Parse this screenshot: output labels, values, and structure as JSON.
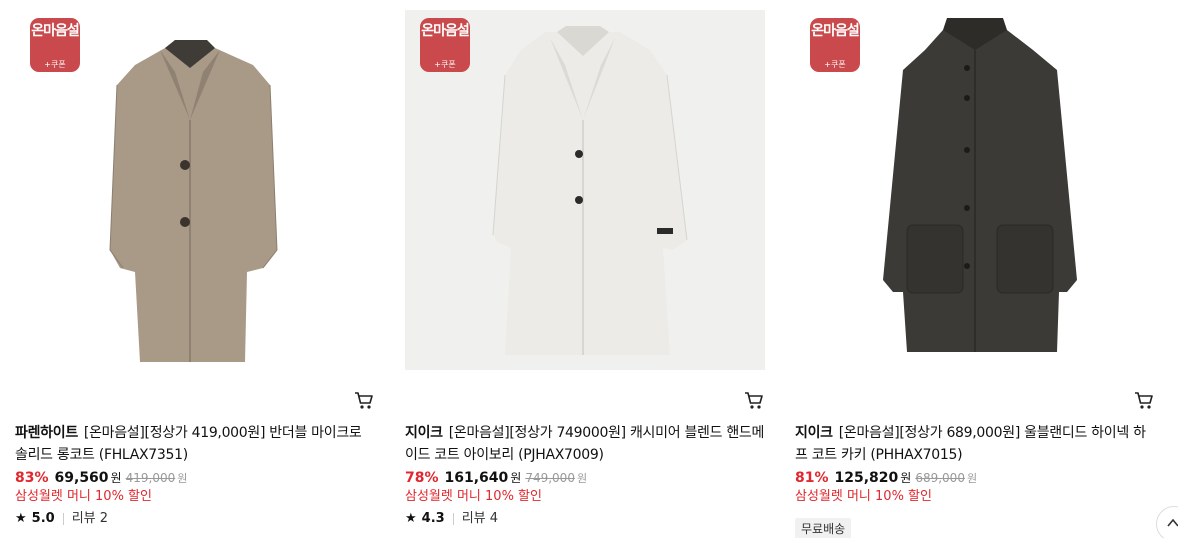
{
  "products": [
    {
      "badge_main": "온마음설",
      "badge_sub": "+쿠폰",
      "brand": "파렌하이트",
      "name": "[온마음설][정상가 419,000원] 반더블 마이크로 솔리드 롱코트 (FHLAX7351)",
      "discount_rate": "83%",
      "sale_price": "69,560",
      "currency": "원",
      "original_price": "419,000",
      "promo": "삼성월렛 머니 10% 할인",
      "rating": "5.0",
      "reviews": "리뷰 2",
      "image_icon": "coat-beige-image",
      "coat_color": "#a89886"
    },
    {
      "badge_main": "온마음설",
      "badge_sub": "+쿠폰",
      "brand": "지이크",
      "name": "[온마음설][정상가 749000원] 캐시미어 블렌드 핸드메이드 코트 아이보리 (PJHAX7009)",
      "discount_rate": "78%",
      "sale_price": "161,640",
      "currency": "원",
      "original_price": "749,000",
      "promo": "삼성월렛 머니 10% 할인",
      "rating": "4.3",
      "reviews": "리뷰 4",
      "image_icon": "coat-ivory-image",
      "coat_color": "#e9e7e2"
    },
    {
      "badge_main": "온마음설",
      "badge_sub": "+쿠폰",
      "brand": "지이크",
      "name": "[온마음설][정상가 689,000원] 울블랜디드 하이넥 하프 코트 카키 (PHHAX7015)",
      "discount_rate": "81%",
      "sale_price": "125,820",
      "currency": "원",
      "original_price": "689,000",
      "promo": "삼성월렛 머니 10% 할인",
      "shipping_tag": "무료배송",
      "image_icon": "coat-khaki-image",
      "coat_color": "#3c3b37"
    }
  ],
  "icons": {
    "cart": "cart-icon",
    "star": "star-icon",
    "scroll_top": "chevron-up-icon"
  },
  "colors": {
    "accent_red": "#e0282e",
    "badge_red": "#c9494c"
  }
}
